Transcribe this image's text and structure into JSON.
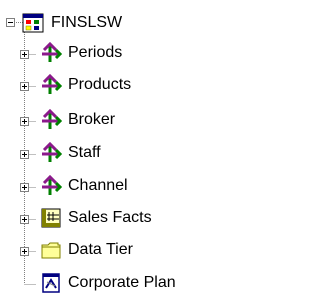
{
  "tree": {
    "root": {
      "label": "FINSLSW",
      "icon": "cube-database-icon",
      "expanded": true
    },
    "children": [
      {
        "label": "Periods",
        "icon": "dimension-arrows-icon",
        "expandable": true
      },
      {
        "label": "Products",
        "icon": "dimension-arrows-icon",
        "expandable": true
      },
      {
        "label": "Broker",
        "icon": "dimension-arrows-icon",
        "expandable": true
      },
      {
        "label": "Staff",
        "icon": "dimension-arrows-icon",
        "expandable": true
      },
      {
        "label": "Channel",
        "icon": "dimension-arrows-icon",
        "expandable": true
      },
      {
        "label": "Sales Facts",
        "icon": "fact-table-icon",
        "expandable": true
      },
      {
        "label": "Data Tier",
        "icon": "folder-icon",
        "expandable": true
      },
      {
        "label": "Corporate Plan",
        "icon": "document-icon",
        "expandable": false
      }
    ]
  },
  "colors": {
    "dotted_line": "#808080",
    "arrow_purple": "#8b1a8b",
    "arrow_green": "#008000",
    "folder_yellow": "#ffff99"
  }
}
